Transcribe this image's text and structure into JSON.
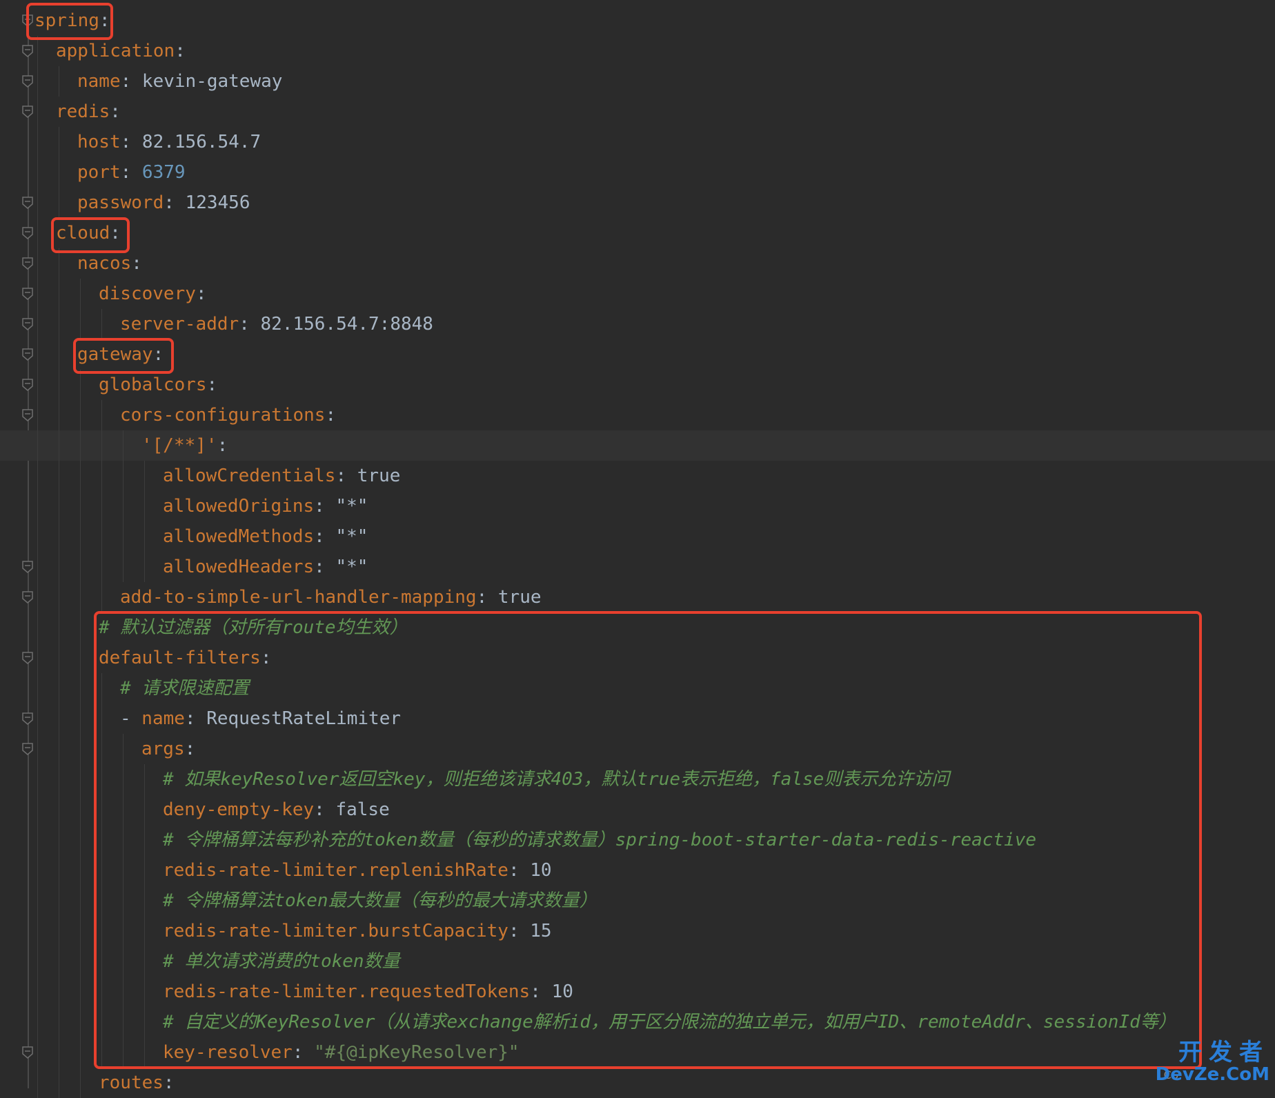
{
  "lines": [
    {
      "indent": 0,
      "key": "spring",
      "sep": ":"
    },
    {
      "indent": 1,
      "key": "application",
      "sep": ":"
    },
    {
      "indent": 2,
      "key": "name",
      "sep": ": ",
      "value": "kevin-gateway",
      "vtype": "val"
    },
    {
      "indent": 1,
      "key": "redis",
      "sep": ":"
    },
    {
      "indent": 2,
      "key": "host",
      "sep": ": ",
      "value": "82.156.54.7",
      "vtype": "val"
    },
    {
      "indent": 2,
      "key": "port",
      "sep": ": ",
      "value": "6379",
      "vtype": "num"
    },
    {
      "indent": 2,
      "key": "password",
      "sep": ": ",
      "value": "123456",
      "vtype": "val"
    },
    {
      "indent": 1,
      "key": "cloud",
      "sep": ":"
    },
    {
      "indent": 2,
      "key": "nacos",
      "sep": ":"
    },
    {
      "indent": 3,
      "key": "discovery",
      "sep": ":"
    },
    {
      "indent": 4,
      "key": "server-addr",
      "sep": ": ",
      "value": "82.156.54.7:8848",
      "vtype": "val"
    },
    {
      "indent": 2,
      "key": "gateway",
      "sep": ":"
    },
    {
      "indent": 3,
      "key": "globalcors",
      "sep": ":"
    },
    {
      "indent": 4,
      "key": "cors-configurations",
      "sep": ":"
    },
    {
      "indent": 5,
      "key": "'[/**]'",
      "sep": ":",
      "highlight": true
    },
    {
      "indent": 6,
      "key": "allowCredentials",
      "sep": ": ",
      "value": "true",
      "vtype": "val"
    },
    {
      "indent": 6,
      "key": "allowedOrigins",
      "sep": ": ",
      "value": "\"*\"",
      "vtype": "val"
    },
    {
      "indent": 6,
      "key": "allowedMethods",
      "sep": ": ",
      "value": "\"*\"",
      "vtype": "val"
    },
    {
      "indent": 6,
      "key": "allowedHeaders",
      "sep": ": ",
      "value": "\"*\"",
      "vtype": "val"
    },
    {
      "indent": 4,
      "key": "add-to-simple-url-handler-mapping",
      "sep": ": ",
      "value": "true",
      "vtype": "val"
    },
    {
      "indent": 3,
      "comment": "# 默认过滤器（对所有route均生效）"
    },
    {
      "indent": 3,
      "key": "default-filters",
      "sep": ":"
    },
    {
      "indent": 4,
      "comment": "# 请求限速配置"
    },
    {
      "indent": 4,
      "dash": "- ",
      "key": "name",
      "sep": ": ",
      "value": "RequestRateLimiter",
      "vtype": "val"
    },
    {
      "indent": 5,
      "key": "args",
      "sep": ":"
    },
    {
      "indent": 6,
      "comment": "# 如果keyResolver返回空key，则拒绝该请求403，默认true表示拒绝，false则表示允许访问"
    },
    {
      "indent": 6,
      "key": "deny-empty-key",
      "sep": ": ",
      "value": "false",
      "vtype": "val"
    },
    {
      "indent": 6,
      "comment": "# 令牌桶算法每秒补充的token数量（每秒的请求数量）spring-boot-starter-data-redis-reactive"
    },
    {
      "indent": 6,
      "key": "redis-rate-limiter.replenishRate",
      "sep": ": ",
      "value": "10",
      "vtype": "val"
    },
    {
      "indent": 6,
      "comment": "# 令牌桶算法token最大数量（每秒的最大请求数量）"
    },
    {
      "indent": 6,
      "key": "redis-rate-limiter.burstCapacity",
      "sep": ": ",
      "value": "15",
      "vtype": "val"
    },
    {
      "indent": 6,
      "comment": "# 单次请求消费的token数量"
    },
    {
      "indent": 6,
      "key": "redis-rate-limiter.requestedTokens",
      "sep": ": ",
      "value": "10",
      "vtype": "val"
    },
    {
      "indent": 6,
      "comment": "# 自定义的KeyResolver（从请求exchange解析id，用于区分限流的独立单元，如用户ID、remoteAddr、sessionId等）"
    },
    {
      "indent": 6,
      "key": "key-resolver",
      "sep": ": ",
      "value": "\"#{@ipKeyResolver}\"",
      "vtype": "str"
    },
    {
      "indent": 3,
      "key": "routes",
      "sep": ":"
    }
  ],
  "watermark": {
    "top": "开发者",
    "bottom": "DevZe.CoM",
    "small": "CS"
  }
}
